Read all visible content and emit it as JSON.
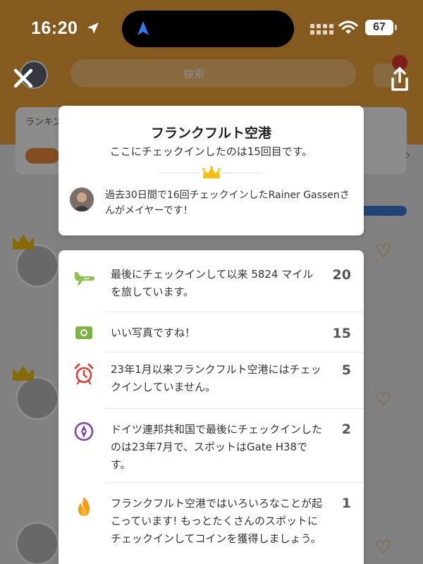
{
  "status_bar": {
    "time": "16:20",
    "battery": "67"
  },
  "background": {
    "search_placeholder": "検索",
    "rank_label": "ランキング"
  },
  "venue": {
    "name": "フランクフルト空港",
    "checkin_count_text": "ここにチェックインしたのは15回目です。",
    "mayor_text": "過去30日間で16回チェックインしたRainer Gassenさんがメイヤーです！"
  },
  "stats": [
    {
      "icon": "airplane-icon",
      "text": "最後にチェックインして以来 5824 マイル を旅しています。",
      "value": "20"
    },
    {
      "icon": "camera-icon",
      "text": "いい写真ですね！",
      "value": "15"
    },
    {
      "icon": "alarm-clock-icon",
      "text": "23年1月以来フランクフルト空港にはチェックインしていません。",
      "value": "5"
    },
    {
      "icon": "compass-icon",
      "text": "ドイツ連邦共和国で最後にチェックインしたのは23年7月で、スポットはGate H38です。",
      "value": "2"
    },
    {
      "icon": "flame-icon",
      "text": "フランクフルト空港ではいろいろなことが起こっています! もっとたくさんのスポットにチェックインしてコインを獲得しましょう。",
      "value": "1"
    }
  ],
  "colors": {
    "header_orange": "#f2a53a",
    "airplane_green": "#8bc34a",
    "camera_green": "#7cb342",
    "alarm_red": "#e53935",
    "compass_purple": "#7e3fb3",
    "flame_orange": "#f39c12"
  }
}
